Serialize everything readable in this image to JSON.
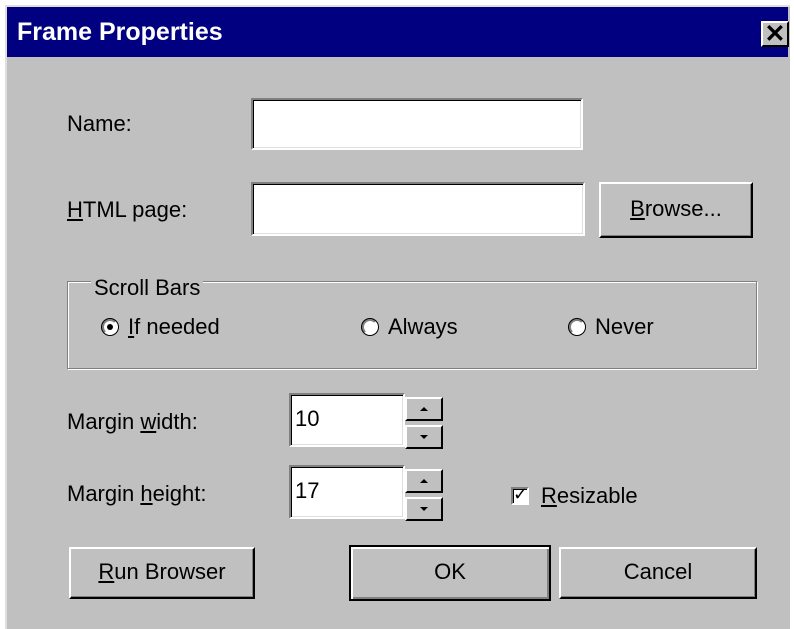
{
  "dialog": {
    "title": "Frame Properties",
    "close_symbol": "✕"
  },
  "name": {
    "label": "Name:",
    "value": ""
  },
  "html_page": {
    "label_accel": "H",
    "label_rest": "TML page:",
    "value": "",
    "browse_accel": "B",
    "browse_rest": "rowse..."
  },
  "scroll_bars": {
    "legend": "Scroll Bars",
    "options": [
      {
        "accel": "I",
        "rest": "f needed",
        "checked": true
      },
      {
        "accel": "",
        "rest": "Always",
        "checked": false
      },
      {
        "accel": "",
        "rest": "Never",
        "checked": false
      }
    ]
  },
  "margin_width": {
    "label_pre": "Margin ",
    "label_accel": "w",
    "label_post": "idth:",
    "value": "10"
  },
  "margin_height": {
    "label_pre": "Margin ",
    "label_accel": "h",
    "label_post": "eight:",
    "value": "17"
  },
  "resizable": {
    "accel": "R",
    "rest": "esizable",
    "checked": true,
    "check_glyph": "✓"
  },
  "buttons": {
    "run_browser_accel": "R",
    "run_browser_rest": "un Browser",
    "ok": "OK",
    "cancel": "Cancel"
  },
  "icons": {
    "close": "close-icon",
    "spin_up": "up-arrow-icon",
    "spin_down": "down-arrow-icon"
  },
  "colors": {
    "titlebar": "#000080",
    "face": "#c0c0c0"
  }
}
